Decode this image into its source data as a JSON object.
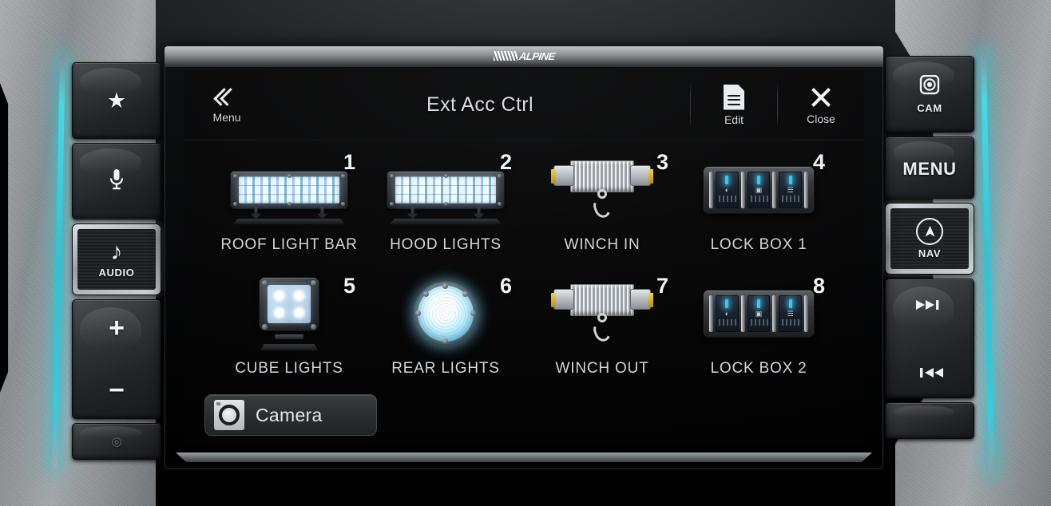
{
  "device": {
    "brand_logo": "ALPINE",
    "left_keys": [
      {
        "name": "favorites",
        "icon": "star-icon",
        "glyph": "★",
        "label": ""
      },
      {
        "name": "voice",
        "icon": "microphone-icon",
        "glyph": "Ἲ4",
        "label": ""
      },
      {
        "name": "audio",
        "icon": "music-note-icon",
        "glyph": "♪",
        "label": "AUDIO"
      },
      {
        "name": "volume-up",
        "icon": "plus-icon",
        "glyph": "+",
        "label": ""
      },
      {
        "name": "volume-down",
        "icon": "minus-icon",
        "glyph": "−",
        "label": ""
      },
      {
        "name": "power",
        "icon": "power-icon",
        "glyph": "◎",
        "label": ""
      }
    ],
    "right_keys": [
      {
        "name": "camera",
        "icon": "camera-icon",
        "glyph": "◎",
        "label": "CAM"
      },
      {
        "name": "menu",
        "icon": "",
        "glyph": "",
        "label": "MENU"
      },
      {
        "name": "nav",
        "icon": "nav-arrow-icon",
        "glyph": "▲",
        "label": "NAV"
      },
      {
        "name": "next-track",
        "icon": "next-track-icon",
        "glyph": "▶▶▏",
        "label": ""
      },
      {
        "name": "prev-track",
        "icon": "prev-track-icon",
        "glyph": "▏◀◀",
        "label": ""
      }
    ],
    "accent_color": "#2ec4d4"
  },
  "screen": {
    "header": {
      "title": "Ext Acc Ctrl",
      "menu_label": "Menu",
      "edit_label": "Edit",
      "close_label": "Close"
    },
    "accessories": [
      {
        "number": "1",
        "label": "ROOF LIGHT BAR",
        "art": "light-bar"
      },
      {
        "number": "2",
        "label": "HOOD LIGHTS",
        "art": "light-bar"
      },
      {
        "number": "3",
        "label": "WINCH IN",
        "art": "winch"
      },
      {
        "number": "4",
        "label": "LOCK BOX 1",
        "art": "switch-panel"
      },
      {
        "number": "5",
        "label": "CUBE LIGHTS",
        "art": "cube-light"
      },
      {
        "number": "6",
        "label": "REAR LIGHTS",
        "art": "round-light"
      },
      {
        "number": "7",
        "label": "WINCH OUT",
        "art": "winch"
      },
      {
        "number": "8",
        "label": "LOCK BOX 2",
        "art": "switch-panel"
      }
    ],
    "footer": {
      "camera_label": "Camera"
    }
  }
}
